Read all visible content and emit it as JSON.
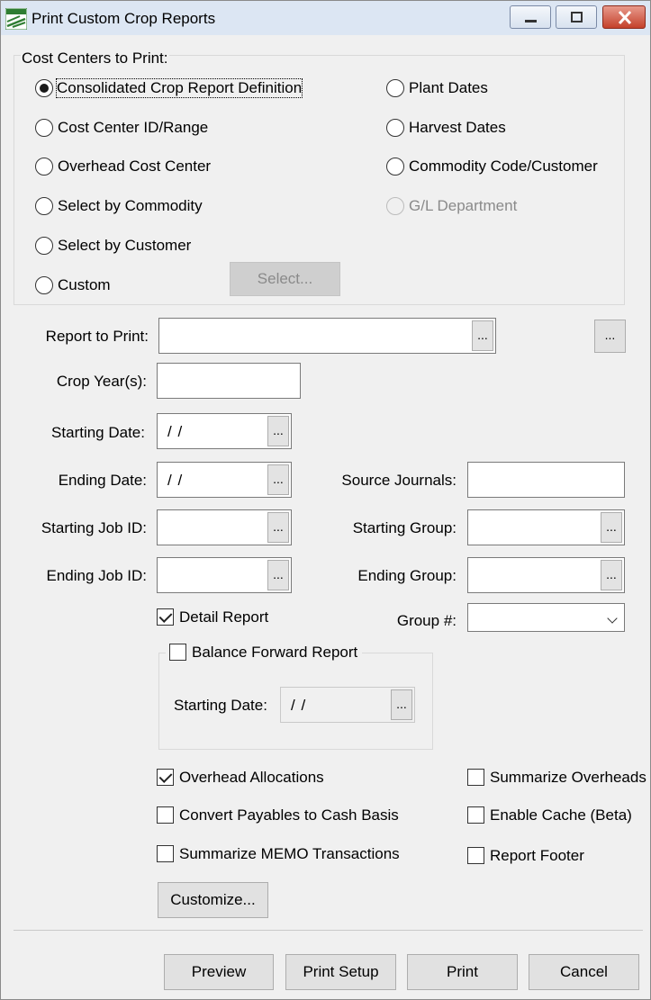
{
  "window": {
    "title": "Print Custom Crop Reports"
  },
  "cost_centers": {
    "legend": "Cost Centers to Print:",
    "options": [
      {
        "label": "Consolidated Crop Report Definition",
        "checked": true,
        "enabled": true
      },
      {
        "label": "Cost Center ID/Range",
        "checked": false,
        "enabled": true
      },
      {
        "label": "Overhead Cost Center",
        "checked": false,
        "enabled": true
      },
      {
        "label": "Select by Commodity",
        "checked": false,
        "enabled": true
      },
      {
        "label": "Select by Customer",
        "checked": false,
        "enabled": true
      },
      {
        "label": "Custom",
        "checked": false,
        "enabled": true
      },
      {
        "label": "Plant Dates",
        "checked": false,
        "enabled": true
      },
      {
        "label": "Harvest Dates",
        "checked": false,
        "enabled": true
      },
      {
        "label": "Commodity Code/Customer",
        "checked": false,
        "enabled": true
      },
      {
        "label": "G/L Department",
        "checked": false,
        "enabled": false
      }
    ],
    "select_button": "Select..."
  },
  "fields": {
    "report_to_print": {
      "label": "Report to Print:",
      "value": ""
    },
    "crop_years": {
      "label": "Crop Year(s):",
      "value": ""
    },
    "starting_date": {
      "label": "Starting Date:",
      "value": "/ /"
    },
    "ending_date": {
      "label": "Ending Date:",
      "value": "/ /"
    },
    "starting_job_id": {
      "label": "Starting Job ID:",
      "value": ""
    },
    "ending_job_id": {
      "label": "Ending Job ID:",
      "value": ""
    },
    "source_journals": {
      "label": "Source Journals:",
      "value": ""
    },
    "starting_group": {
      "label": "Starting Group:",
      "value": ""
    },
    "ending_group": {
      "label": "Ending Group:",
      "value": ""
    },
    "group_num": {
      "label": "Group #:",
      "value": ""
    },
    "ellipsis": "..."
  },
  "detail_report": {
    "label": "Detail Report",
    "checked": true
  },
  "balance_forward": {
    "label": "Balance Forward Report",
    "checked": false,
    "starting_date_label": "Starting Date:",
    "starting_date_value": "/ /"
  },
  "options": {
    "overhead_allocations": {
      "label": "Overhead Allocations",
      "checked": true
    },
    "convert_payables": {
      "label": "Convert Payables to Cash Basis",
      "checked": false
    },
    "summarize_memo": {
      "label": "Summarize MEMO Transactions",
      "checked": false
    },
    "summarize_overheads": {
      "label": "Summarize Overheads",
      "checked": false
    },
    "enable_cache": {
      "label": "Enable Cache (Beta)",
      "checked": false
    },
    "report_footer": {
      "label": "Report Footer",
      "checked": false
    }
  },
  "customize_button": "Customize...",
  "footer_buttons": {
    "preview": "Preview",
    "print_setup": "Print Setup",
    "print": "Print",
    "cancel": "Cancel"
  },
  "colors": {
    "window_bg": "#f0f0f0",
    "title_bg": "#dce6f3",
    "close_red": "#c4412b",
    "app_icon_green": "#2e7d32"
  }
}
